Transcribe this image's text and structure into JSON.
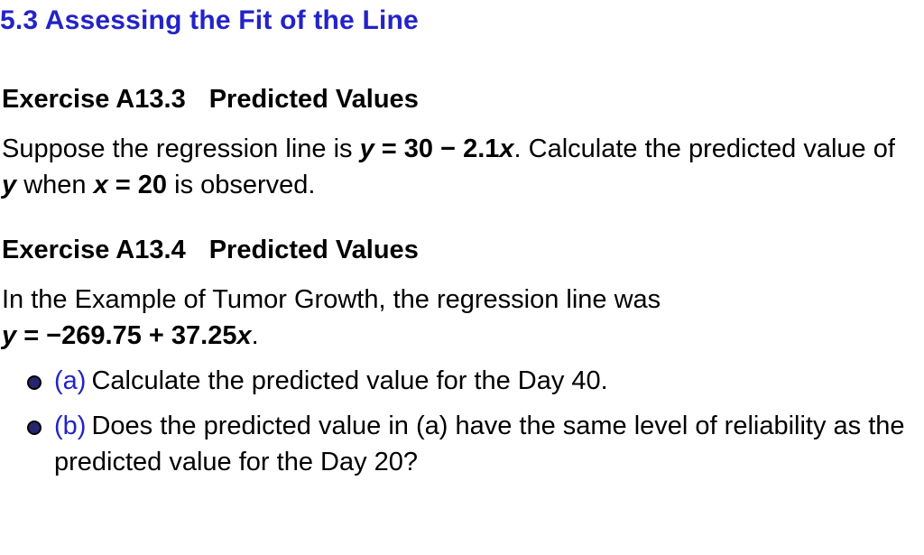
{
  "section": {
    "number": "5.3",
    "title": "Assessing the Fit of the Line"
  },
  "exercises": [
    {
      "label": "Exercise A13.3",
      "title": "Predicted Values",
      "prompt": {
        "lead": "Suppose the regression line is ",
        "eq_lhs": "y",
        "eq_eq": " = ",
        "eq_rhs_a": "30 − 2.1",
        "eq_rhs_var": "x",
        "after_eq": ". Calculate the predicted value of ",
        "y_var": "y",
        "when_text": " when ",
        "x_var": "x",
        "x_eq": " = ",
        "x_val": "20",
        "tail": " is observed."
      }
    },
    {
      "label": "Exercise A13.4",
      "title": "Predicted Values",
      "prompt2": {
        "lead": "In the Example of Tumor Growth, the regression line was",
        "eq_lhs": "y",
        "eq_eq": " = ",
        "eq_rhs_a": "−269.75 + 37.25",
        "eq_rhs_var": "x",
        "tail": "."
      },
      "parts": [
        {
          "label": "(a)",
          "text": "Calculate the predicted value for the Day 40."
        },
        {
          "label": "(b)",
          "text": "Does the predicted value in (a) have the same level of reliability as the predicted value for the Day 20?"
        }
      ]
    }
  ]
}
